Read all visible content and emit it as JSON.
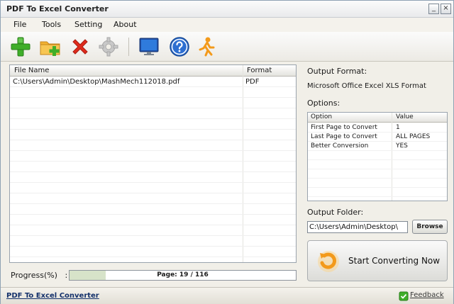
{
  "window": {
    "title": "PDF To Excel Converter",
    "minimize_glyph": "_",
    "close_glyph": "×"
  },
  "menu": {
    "items": [
      "File",
      "Tools",
      "Setting",
      "About"
    ]
  },
  "toolbar": {
    "icons": [
      "add-file-icon",
      "add-folder-icon",
      "remove-icon",
      "settings-gear-icon",
      "monitor-icon",
      "help-icon",
      "run-person-icon"
    ]
  },
  "file_list": {
    "columns": [
      "File Name",
      "Format"
    ],
    "rows": [
      {
        "name": "C:\\Users\\Admin\\Desktop\\MashMech112018.pdf",
        "format": "PDF"
      }
    ]
  },
  "progress": {
    "label": "Progress(%)",
    "separator": ":",
    "text": "Page: 19 / 116",
    "fraction": 0.16
  },
  "output": {
    "format_label": "Output Format:",
    "format_value": "Microsoft Office Excel XLS Format",
    "options_label": "Options:",
    "options_columns": [
      "Option",
      "Value"
    ],
    "options": [
      {
        "option": "First Page to Convert",
        "value": "1"
      },
      {
        "option": "Last Page to Convert",
        "value": "ALL PAGES"
      },
      {
        "option": "Better Conversion",
        "value": "YES"
      }
    ],
    "folder_label": "Output Folder:",
    "folder_value": "C:\\Users\\Admin\\Desktop\\",
    "browse_label": "Browse",
    "convert_label": "Start Converting Now"
  },
  "status": {
    "link_text": "PDF To Excel Converter",
    "feedback_label": "Feedback"
  },
  "colors": {
    "accent_green": "#3fae29",
    "accent_red": "#e02b1c",
    "link_blue": "#14316b",
    "convert_orange": "#f39a1b"
  }
}
